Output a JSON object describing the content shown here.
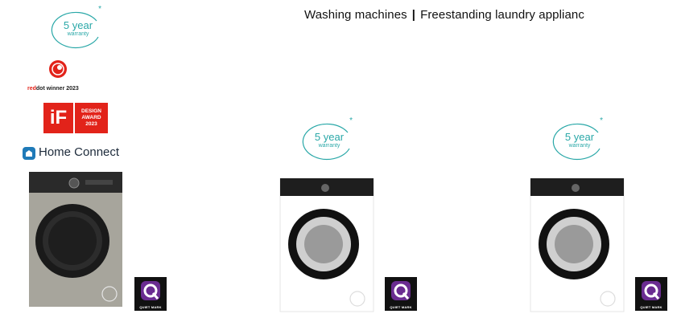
{
  "header": {
    "category": "Washing machines",
    "separator": "|",
    "subcategory": "Freestanding laundry applianc"
  },
  "warranty": {
    "years": "5 year",
    "label": "warranty",
    "asterisk": "*"
  },
  "awards": {
    "reddot": {
      "brand_red": "red",
      "brand_dot": "dot",
      "rest": " winner 2023"
    },
    "if": {
      "mark": "iF",
      "lines": [
        "DESIGN",
        "AWARD",
        "2023"
      ]
    }
  },
  "home_connect": {
    "label": "Home Connect",
    "icon": "home-connect-icon"
  },
  "products": [
    {
      "finish": "silver",
      "quiet_mark": "QUIET MARK"
    },
    {
      "finish": "white",
      "quiet_mark": "QUIET MARK"
    },
    {
      "finish": "white",
      "quiet_mark": "QUIET MARK"
    }
  ],
  "colors": {
    "teal": "#2aa8a8",
    "red": "#e2231a",
    "quiet_mark_purple": "#6a2c91"
  }
}
